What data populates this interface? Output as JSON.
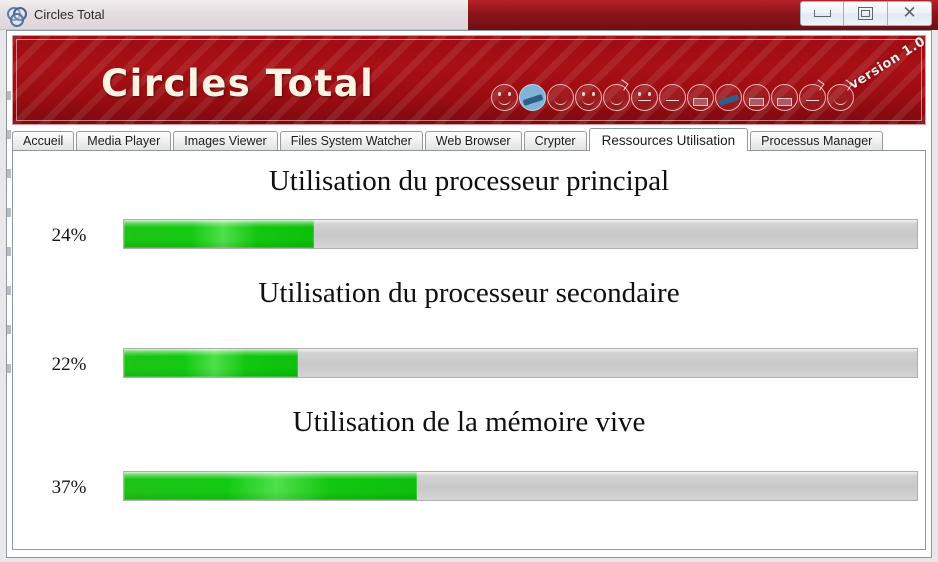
{
  "window": {
    "title": "Circles Total",
    "icon": "circles-logo-icon",
    "controls": {
      "minimize": "minimize-icon",
      "maximize": "maximize-icon",
      "close": "✕"
    }
  },
  "banner": {
    "brand": "Circles Total",
    "version": "version 1.0",
    "icons": [
      {
        "name": "smiley-happy-icon",
        "style": "smile"
      },
      {
        "name": "smiley-blue-icon",
        "style": "blue"
      },
      {
        "name": "smiley-wink-icon",
        "style": "wink"
      },
      {
        "name": "smiley-grin-icon",
        "style": "smile"
      },
      {
        "name": "smiley-tongue-icon",
        "style": "wink"
      },
      {
        "name": "smiley-wide-eyes-icon",
        "style": "eyes"
      },
      {
        "name": "smiley-neutral-icon",
        "style": "flat"
      },
      {
        "name": "smiley-bar-icon",
        "style": "bar"
      },
      {
        "name": "smiley-slash-icon",
        "style": "slash"
      },
      {
        "name": "smiley-bar2-icon",
        "style": "bar"
      },
      {
        "name": "smiley-battery-icon",
        "style": "bar"
      },
      {
        "name": "smiley-clock-icon",
        "style": "antenna"
      },
      {
        "name": "smiley-sad-icon",
        "style": "antenna"
      }
    ]
  },
  "tabs": [
    {
      "label": "Accueil",
      "active": false
    },
    {
      "label": "Media Player",
      "active": false
    },
    {
      "label": "Images Viewer",
      "active": false
    },
    {
      "label": "Files System Watcher",
      "active": false
    },
    {
      "label": "Web Browser",
      "active": false
    },
    {
      "label": "Crypter",
      "active": false
    },
    {
      "label": "Ressources Utilisation",
      "active": true
    },
    {
      "label": "Processus Manager",
      "active": false
    }
  ],
  "resources": [
    {
      "title": "Utilisation du processeur principal",
      "percent_label": "24%",
      "percent": 24
    },
    {
      "title": "Utilisation du processeur secondaire",
      "percent_label": "22%",
      "percent": 22
    },
    {
      "title": "Utilisation de la mémoire vive",
      "percent_label": "37%",
      "percent": 37
    }
  ],
  "colors": {
    "banner_red": "#a81015",
    "brand_cream": "#fdf3e3",
    "progress_green": "#12c70f",
    "progress_track": "#c8c8c8"
  }
}
